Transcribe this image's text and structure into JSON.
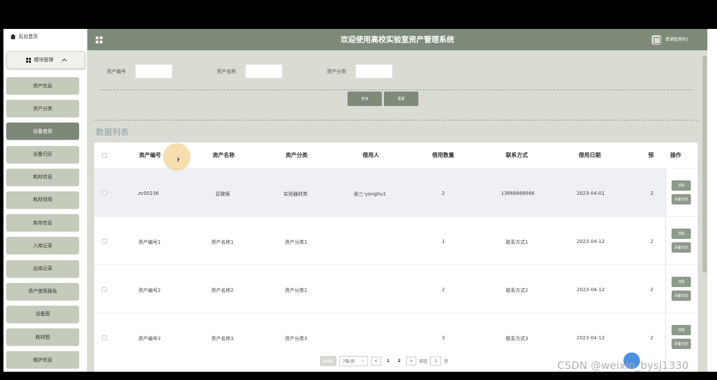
{
  "sidebar": {
    "home_label": "后台首页",
    "module_label": "模块管理",
    "items": [
      {
        "label": "资产信息"
      },
      {
        "label": "资产分类"
      },
      {
        "label": "设备借用",
        "active": true
      },
      {
        "label": "设备归还"
      },
      {
        "label": "耗材信息"
      },
      {
        "label": "耗材领用"
      },
      {
        "label": "库存信息"
      },
      {
        "label": "入库记录"
      },
      {
        "label": "出库记录"
      },
      {
        "label": "资产使用报告"
      },
      {
        "label": "设备图"
      },
      {
        "label": "耗材图"
      },
      {
        "label": "维护信息"
      }
    ]
  },
  "header": {
    "title": "欢迎使用高校实验室资产管理系统",
    "user": "普通管理员1"
  },
  "search": {
    "asset_no_label": "资产编号",
    "asset_name_label": "资产名称",
    "asset_category_label": "资产分类",
    "query_button": "查询",
    "reset_button": "重置"
  },
  "list_title": "数据列表",
  "table": {
    "headers": [
      "资产编号",
      "资产名称",
      "资产分类",
      "借用人",
      "借用数量",
      "联系方式",
      "借用日期",
      "预",
      "操作"
    ],
    "rows": [
      [
        "zc00236",
        "显微镜",
        "实验器材类",
        "张三-yonghu1",
        "2",
        "13666666666",
        "2023-04-01",
        "2"
      ],
      [
        "资产编号1",
        "资产名称1",
        "资产分类1",
        "",
        "1",
        "联系方式1",
        "2023-04-12",
        "2"
      ],
      [
        "资产编号2",
        "资产名称2",
        "资产分类2",
        "",
        "2",
        "联系方式2",
        "2023-04-12",
        "2"
      ],
      [
        "资产编号3",
        "资产名称3",
        "资产分类3",
        "",
        "3",
        "联系方式3",
        "2023-04-12",
        "2"
      ]
    ],
    "detail_button": "详情",
    "return_button": "设备归还"
  },
  "pager": {
    "total": "共9条",
    "page_size": "7条/页",
    "pages": [
      "1",
      "2"
    ],
    "goto_label": "前往",
    "goto_value": "1",
    "page_unit": "页",
    "prev": "<",
    "next": ">"
  },
  "watermark": "CSDN @weixin_bysj1330",
  "colors": {
    "header_bg": "#7d8a79",
    "menu_bg": "#c5cbbb",
    "menu_active": "#7e8879",
    "content_bg": "#d9dcd3"
  }
}
